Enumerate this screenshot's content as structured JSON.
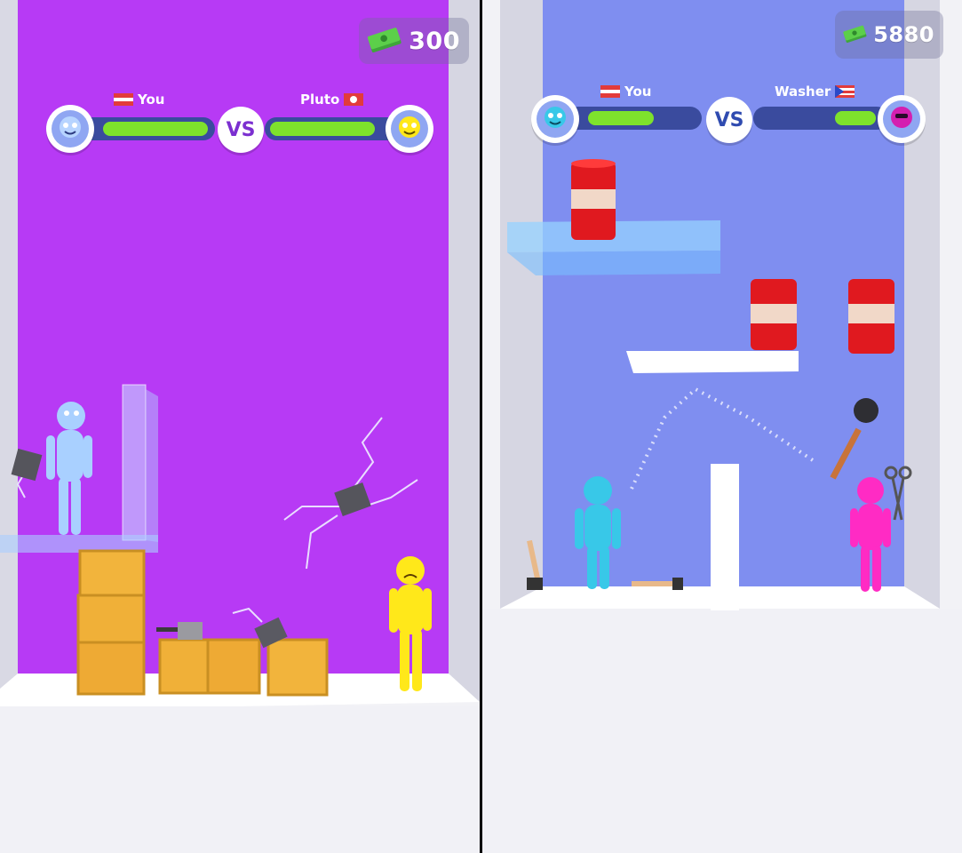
{
  "left_screen": {
    "cash": {
      "icon": "cash-stack-icon",
      "amount": "300"
    },
    "player": {
      "label": "You",
      "flag": "flag-icon",
      "health": 1.0
    },
    "vs_label": "VS",
    "opponent": {
      "label": "Pluto",
      "flag": "flag-icon",
      "health": 1.0
    },
    "colors": {
      "background": "#b73af5",
      "player": "#a9d0ff",
      "opponent": "#ffe81a",
      "hp": "#7ee22c",
      "vs_text": "#7b2fd0"
    }
  },
  "right_screen": {
    "cash": {
      "icon": "cash-stack-icon",
      "amount": "5880"
    },
    "player": {
      "label": "You",
      "flag": "flag-icon",
      "health": 0.62
    },
    "vs_label": "VS",
    "opponent": {
      "label": "Washer",
      "flag": "flag-icon",
      "health": 0.38
    },
    "colors": {
      "background": "#7f8ef0",
      "player": "#38c8e8",
      "opponent": "#ff2bc4",
      "hp": "#7ee22c",
      "vs_text": "#2f4bb0"
    }
  }
}
